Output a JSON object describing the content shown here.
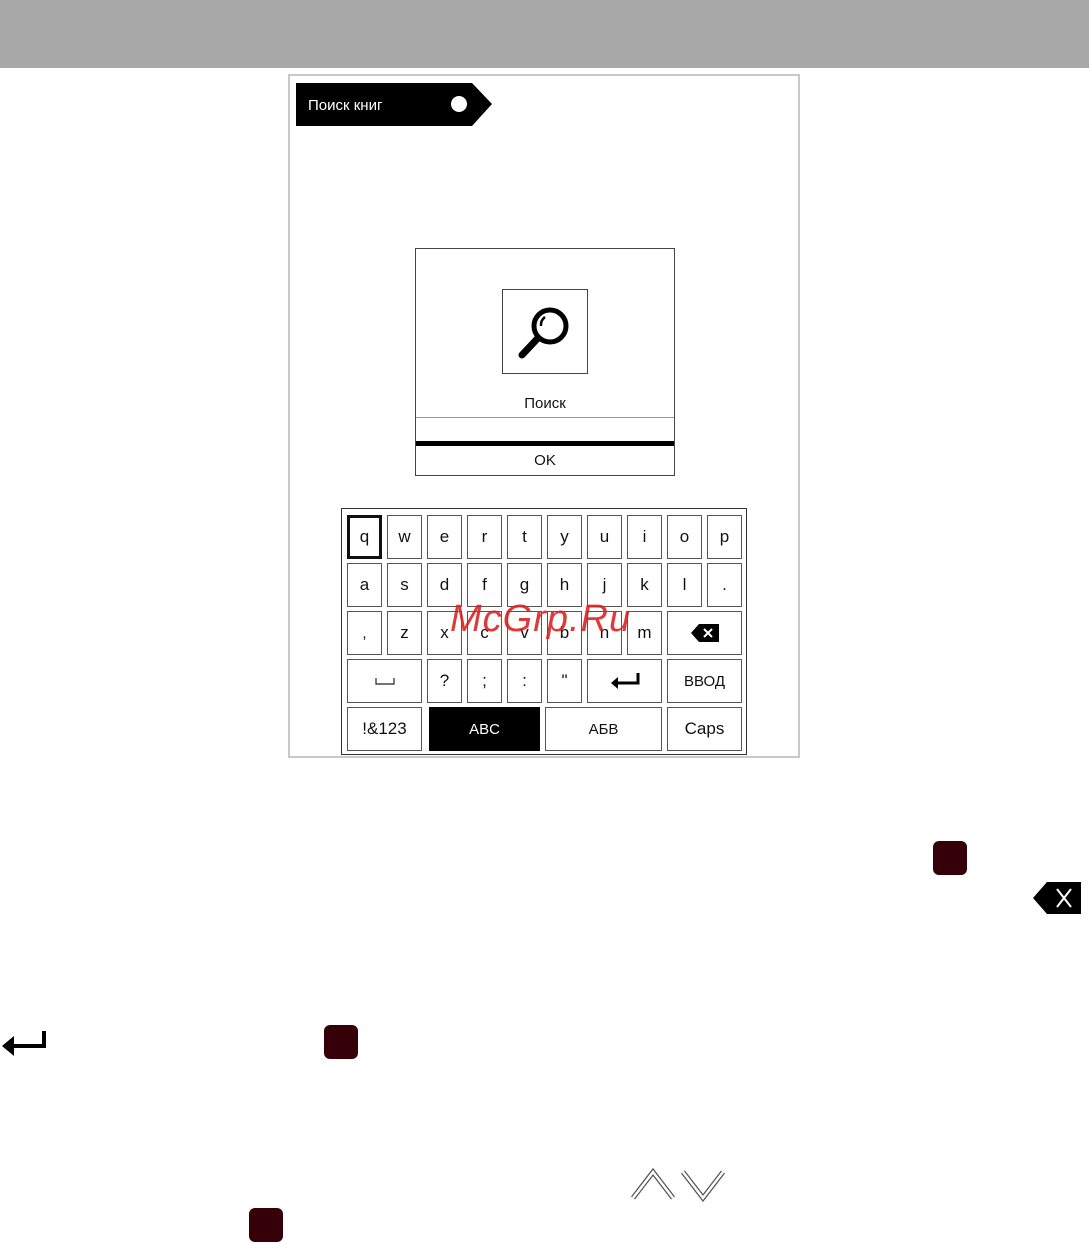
{
  "header": {
    "tag_label": "Поиск книг"
  },
  "dialog": {
    "label": "Поиск",
    "ok_label": "OK"
  },
  "keyboard": {
    "row1": [
      "q",
      "w",
      "e",
      "r",
      "t",
      "y",
      "u",
      "i",
      "o",
      "p"
    ],
    "row2": [
      "a",
      "s",
      "d",
      "f",
      "g",
      "h",
      "j",
      "k",
      "l",
      "."
    ],
    "row3": [
      ",",
      "z",
      "x",
      "c",
      "v",
      "b",
      "n",
      "m"
    ],
    "row4": [
      "?",
      ";",
      ":",
      "\""
    ],
    "enter_label": "ВВОД",
    "row5": {
      "symbols": "!&123",
      "latin": "ABC",
      "cyrillic": "АБВ",
      "caps": "Caps"
    }
  },
  "watermark": "McGrp.Ru",
  "icons": {
    "tag_circle": "circle-icon",
    "search": "magnifier-icon",
    "backspace": "backspace-icon",
    "space": "space-icon",
    "enter": "enter-arrow-icon",
    "close": "x-close-icon",
    "up": "chevron-up-icon",
    "down": "chevron-down-icon"
  },
  "colors": {
    "topbar": "#a9a8a8",
    "dot": "#350007",
    "watermark": "#dc1e1e"
  }
}
